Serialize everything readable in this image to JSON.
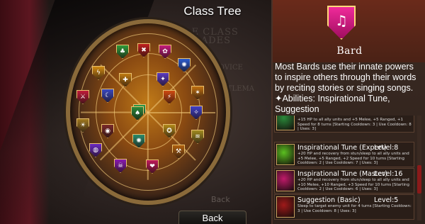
{
  "screen": {
    "title": "Class Tree",
    "back_label": "Back",
    "ghost": {
      "heading": "ABLE CLASS UPGRADES",
      "item_1": "NOVICE",
      "item_2": "BATTLEMA",
      "back": "Back"
    }
  },
  "tree": {
    "nodes": [
      {
        "icon": "plant-icon",
        "glyph": "♣",
        "color": "#2e9a3a"
      },
      {
        "icon": "x-cross-icon",
        "glyph": "✖",
        "color": "#c0201e"
      },
      {
        "icon": "flower-icon",
        "glyph": "✿",
        "color": "#c41c7c"
      },
      {
        "icon": "swirl-icon",
        "glyph": "✺",
        "color": "#2a5ad0"
      },
      {
        "icon": "bolt-icon",
        "glyph": "ϟ",
        "color": "#d08a12"
      },
      {
        "icon": "bird-icon",
        "glyph": "✦",
        "color": "#5a3ac0"
      },
      {
        "icon": "cross-icon",
        "glyph": "✚",
        "color": "#c07a10"
      },
      {
        "icon": "sword-icon",
        "glyph": "⚔",
        "color": "#c01c3a"
      },
      {
        "icon": "moon-icon",
        "glyph": "☾",
        "color": "#3a48c0"
      },
      {
        "icon": "lightning-icon",
        "glyph": "⚡",
        "color": "#d04a10"
      },
      {
        "icon": "fire-icon",
        "glyph": "✶",
        "color": "#c07010"
      },
      {
        "icon": "star-icon",
        "glyph": "✧",
        "color": "#4040c8"
      },
      {
        "icon": "sun-icon",
        "glyph": "☀",
        "color": "#a07820"
      },
      {
        "icon": "eye-icon",
        "glyph": "◉",
        "color": "#7a2a2a"
      },
      {
        "icon": "leaf-icon",
        "glyph": "❦",
        "color": "#2a9a4a"
      },
      {
        "icon": "pentagram-icon",
        "glyph": "✪",
        "color": "#b08818"
      },
      {
        "icon": "wind-icon",
        "glyph": "≋",
        "color": "#a08a20"
      },
      {
        "icon": "orb-icon",
        "glyph": "◍",
        "color": "#6a2ac0"
      },
      {
        "icon": "spiral-icon",
        "glyph": "✺",
        "color": "#2a8a6a"
      },
      {
        "icon": "axe-icon",
        "glyph": "⚒",
        "color": "#b0600e"
      },
      {
        "icon": "skull-icon",
        "glyph": "☠",
        "color": "#8a1ab0"
      },
      {
        "icon": "heart-icon",
        "glyph": "❤",
        "color": "#c01a5a"
      },
      {
        "icon": "tree-icon",
        "glyph": "♠",
        "color": "#2a8a3a"
      }
    ]
  },
  "class_panel": {
    "name": "Bard",
    "crest_icon": "lyre-icon",
    "crest_glyph": "♫",
    "description": "Most Bards use their innate powers to inspire others through their words by reciting stories or singing songs.  ✦Abilities: Inspirational Tune, Suggestion"
  },
  "abilities": [
    {
      "name": "",
      "level": "",
      "detail": "+15 HP to all ally units and +5 Melee, +5 Ranged, +1 Speed for 8 turns [Starting Cooldown: 3 | Use Cooldown: 8 | Uses: 3]",
      "icon": "green-rune-icon",
      "color": "#2a8a3a"
    },
    {
      "name": "Inspirational Tune (Expert)",
      "level": "Level:8",
      "detail": "+20 HP and recovery from stun/sleep to all ally units and +5 Melee, +5 Ranged, +2 Speed for 10 turns [Starting Cooldown: 2 | Use Cooldown: 7 | Uses: 3]",
      "icon": "green-music-icon",
      "color": "#5ac020"
    },
    {
      "name": "Inspirational Tune (Master)",
      "level": "Level:16",
      "detail": "+20 HP and recovery from stun/sleep to all ally units and +10 Melee, +10 Ranged, +3 Speed for 10 turns [Starting Cooldown: 2 | Use Cooldown: 6 | Uses: 3]",
      "icon": "pink-music-icon",
      "color": "#c01a6a"
    },
    {
      "name": "Suggestion (Basic)",
      "level": "Level:5",
      "detail": "Sleep to target enemy unit for 4 turns [Starting Cooldown: 3 | Use Cooldown: 8 | Uses: 3]",
      "icon": "red-swirl-icon",
      "color": "#a01a1a"
    }
  ]
}
